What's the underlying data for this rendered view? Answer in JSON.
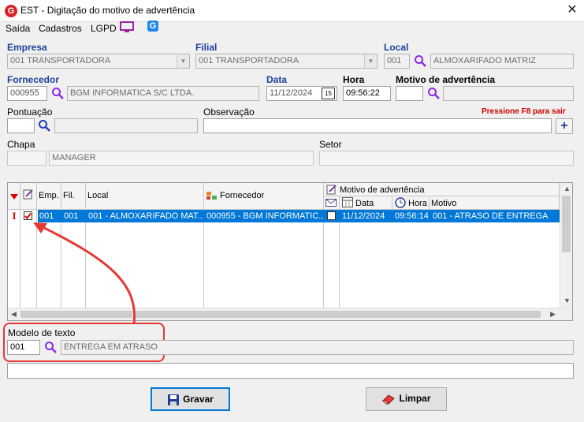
{
  "window": {
    "title": "EST - Digitação do motivo de advertência",
    "close": "✕"
  },
  "menu": {
    "items": [
      "Saída",
      "Cadastros",
      "LGPD"
    ]
  },
  "form": {
    "empresa": {
      "label": "Empresa",
      "value": "001 TRANSPORTADORA"
    },
    "filial": {
      "label": "Filial",
      "value": "001 TRANSPORTADORA"
    },
    "local": {
      "label": "Local",
      "code": "001",
      "name": "ALMOXARIFADO MATRIZ"
    },
    "fornecedor": {
      "label": "Fornecedor",
      "code": "000955",
      "name": "BGM INFORMATICA S/C LTDA."
    },
    "data": {
      "label": "Data",
      "value": "11/12/2024",
      "cal": "15"
    },
    "hora": {
      "label": "Hora",
      "value": "09:56:22"
    },
    "motivo": {
      "label": "Motivo de advertência",
      "code": "",
      "name": ""
    },
    "pontuacao": {
      "label": "Pontuação",
      "value": "",
      "name": ""
    },
    "observacao": {
      "label": "Observação",
      "value": ""
    },
    "hint": "Pressione F8 para sair",
    "plus": "+",
    "chapa": {
      "label": "Chapa",
      "code": "",
      "name": "MANAGER"
    },
    "setor": {
      "label": "Setor",
      "value": ""
    }
  },
  "grid": {
    "group_header": "Motivo de advertência",
    "columns": {
      "emp": "Emp.",
      "fil": "Fil.",
      "local": "Local",
      "fornecedor": "Fornecedor",
      "data": "Data",
      "hora": "Hora",
      "motivo": "Motivo"
    },
    "rows": [
      {
        "emp": "001",
        "fil": "001",
        "local": "001 - ALMOXARIFADO MAT...",
        "fornecedor": "000955 - BGM INFORMATIC...",
        "data": "11/12/2024",
        "hora": "09:56:14",
        "motivo": "001 - ATRASO DE ENTREGA",
        "checked": true,
        "marker": "I"
      }
    ]
  },
  "modelo": {
    "label": "Modelo de texto",
    "code": "001",
    "name": "ENTREGA EM ATRASO"
  },
  "bottom_text": "",
  "buttons": {
    "gravar": "Gravar",
    "limpar": "Limpar"
  },
  "colors": {
    "accent": "#0078d7",
    "label_blue": "#1f3f99",
    "annotation": "#e53935",
    "hint": "#cc0000"
  }
}
